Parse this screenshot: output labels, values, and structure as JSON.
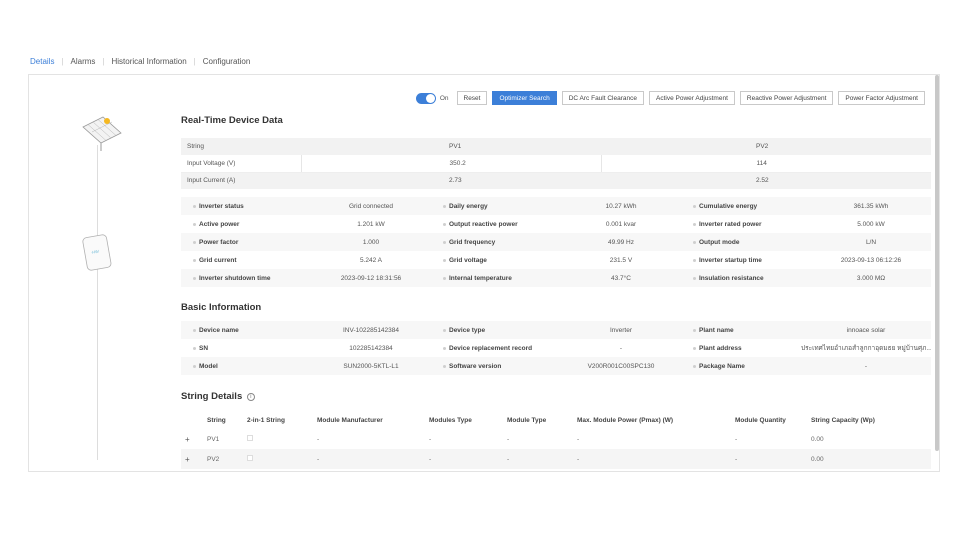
{
  "tabs": [
    {
      "label": "Details",
      "active": true
    },
    {
      "label": "Alarms"
    },
    {
      "label": "Historical Information"
    },
    {
      "label": "Configuration"
    }
  ],
  "toolbar": {
    "toggle_label": "On",
    "toggle_on": true,
    "reset": "Reset",
    "optimizer_search": "Optimizer Search",
    "dc_arc": "DC Arc Fault Clearance",
    "active_power": "Active Power Adjustment",
    "reactive_power": "Reactive Power Adjustment",
    "power_factor": "Power Factor Adjustment"
  },
  "realtime": {
    "title": "Real-Time Device Data",
    "string_table": {
      "row_string": {
        "label": "String",
        "pv1": "PV1",
        "pv2": "PV2"
      },
      "row_voltage": {
        "label": "Input Voltage (V)",
        "pv1": "350.2",
        "pv2": "114"
      },
      "row_current": {
        "label": "Input Current (A)",
        "pv1": "2.73",
        "pv2": "2.52"
      }
    },
    "rows": [
      [
        {
          "k": "Inverter status",
          "v": "Grid connected"
        },
        {
          "k": "Daily energy",
          "v": "10.27 kWh"
        },
        {
          "k": "Cumulative energy",
          "v": "361.35 kWh"
        }
      ],
      [
        {
          "k": "Active power",
          "v": "1.201 kW"
        },
        {
          "k": "Output reactive power",
          "v": "0.001 kvar"
        },
        {
          "k": "Inverter rated power",
          "v": "5.000 kW"
        }
      ],
      [
        {
          "k": "Power factor",
          "v": "1.000"
        },
        {
          "k": "Grid frequency",
          "v": "49.99 Hz"
        },
        {
          "k": "Output mode",
          "v": "L/N"
        }
      ],
      [
        {
          "k": "Grid current",
          "v": "5.242 A"
        },
        {
          "k": "Grid voltage",
          "v": "231.5 V"
        },
        {
          "k": "Inverter startup time",
          "v": "2023-09-13 06:12:26"
        }
      ],
      [
        {
          "k": "Inverter shutdown time",
          "v": "2023-09-12 18:31:56"
        },
        {
          "k": "Internal temperature",
          "v": "43.7°C"
        },
        {
          "k": "Insulation resistance",
          "v": "3.000 MΩ"
        }
      ]
    ]
  },
  "basic": {
    "title": "Basic Information",
    "rows": [
      [
        {
          "k": "Device name",
          "v": "INV-102285142384"
        },
        {
          "k": "Device type",
          "v": "Inverter"
        },
        {
          "k": "Plant name",
          "v": "innoace solar"
        }
      ],
      [
        {
          "k": "SN",
          "v": "102285142384"
        },
        {
          "k": "Device replacement record",
          "v": "-"
        },
        {
          "k": "Plant address",
          "v": "ประเทศไทยอำเภอสำลูกกาอุดมธย หมู่บ้านศุภ..."
        }
      ],
      [
        {
          "k": "Model",
          "v": "SUN2000-5KTL-L1"
        },
        {
          "k": "Software version",
          "v": "V200R001C00SPC130"
        },
        {
          "k": "Package Name",
          "v": "-"
        }
      ]
    ]
  },
  "strings": {
    "title": "String Details",
    "headers": [
      "String",
      "2-in-1 String",
      "Module Manufacturer",
      "Modules Type",
      "Module Type",
      "Max. Module Power (Pmax) (W)",
      "Module Quantity",
      "String Capacity (Wp)"
    ],
    "rows": [
      {
        "name": "PV1",
        "manufacturer": "-",
        "modules_type": "-",
        "module_type": "-",
        "pmax": "-",
        "quantity": "-",
        "capacity": "0.00"
      },
      {
        "name": "PV2",
        "manufacturer": "-",
        "modules_type": "-",
        "module_type": "-",
        "pmax": "-",
        "quantity": "-",
        "capacity": "0.00"
      }
    ]
  }
}
